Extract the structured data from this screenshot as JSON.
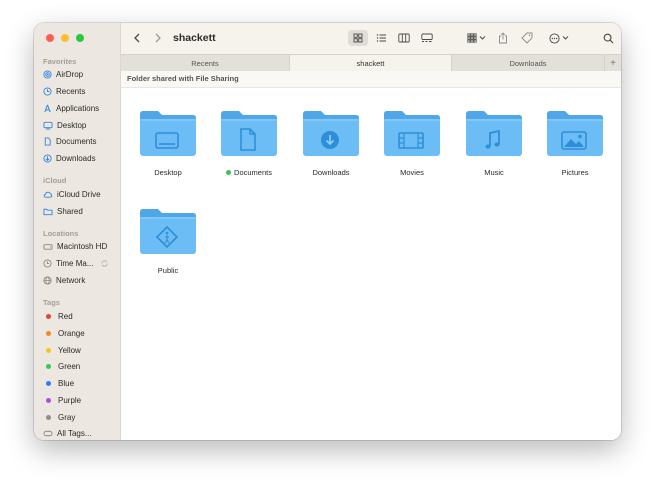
{
  "window": {
    "title": "shackett"
  },
  "sidebar": {
    "sections": {
      "favorites": "Favorites",
      "icloud": "iCloud",
      "locations": "Locations",
      "tags": "Tags"
    },
    "favorites": [
      "AirDrop",
      "Recents",
      "Applications",
      "Desktop",
      "Documents",
      "Downloads"
    ],
    "icloud": [
      "iCloud Drive",
      "Shared"
    ],
    "locations": [
      "Macintosh HD",
      "Time Ma...",
      "Network"
    ],
    "tags": [
      {
        "label": "Red",
        "color": "#e0443a"
      },
      {
        "label": "Orange",
        "color": "#f08a24"
      },
      {
        "label": "Yellow",
        "color": "#f5c518"
      },
      {
        "label": "Green",
        "color": "#3cc557"
      },
      {
        "label": "Blue",
        "color": "#2f7cf6"
      },
      {
        "label": "Purple",
        "color": "#a751d6"
      },
      {
        "label": "Gray",
        "color": "#8e8e8e"
      }
    ],
    "all_tags": "All Tags..."
  },
  "tabs": [
    "Recents",
    "shackett",
    "Downloads"
  ],
  "active_tab": "shackett",
  "banner": "Folder shared with File Sharing",
  "folders": [
    {
      "label": "Desktop",
      "icon": "desktop-glyph"
    },
    {
      "label": "Documents",
      "icon": "document-glyph",
      "tag": "#3cc557"
    },
    {
      "label": "Downloads",
      "icon": "download-glyph"
    },
    {
      "label": "Movies",
      "icon": "film-glyph"
    },
    {
      "label": "Music",
      "icon": "music-note-glyph"
    },
    {
      "label": "Pictures",
      "icon": "picture-glyph"
    },
    {
      "label": "Public",
      "icon": "public-glyph"
    }
  ],
  "colors": {
    "accent": "#2f84e0",
    "folder": "#6cbcf5",
    "folder_dark": "#4fa7e8",
    "sidebar_bg": "#ece8e1"
  }
}
